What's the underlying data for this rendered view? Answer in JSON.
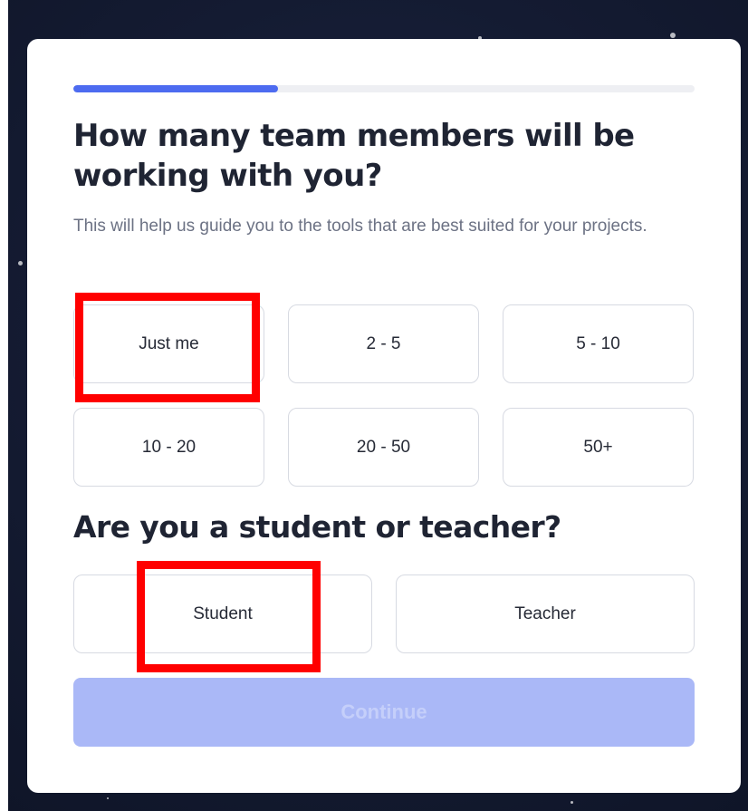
{
  "progress": {
    "fraction": 0.33
  },
  "question1": {
    "title": "How many team members will be working with you?",
    "subtitle": "This will help us guide you to the tools that are best suited for your projects.",
    "options": [
      "Just me",
      "2 - 5",
      "5 - 10",
      "10 - 20",
      "20 - 50",
      "50+"
    ]
  },
  "question2": {
    "title": "Are you a student or teacher?",
    "options": [
      "Student",
      "Teacher"
    ]
  },
  "actions": {
    "continue_label": "Continue"
  },
  "colors": {
    "accent": "#4d6bf0",
    "continue_disabled": "#aab8f7",
    "highlight": "#ff0000"
  }
}
